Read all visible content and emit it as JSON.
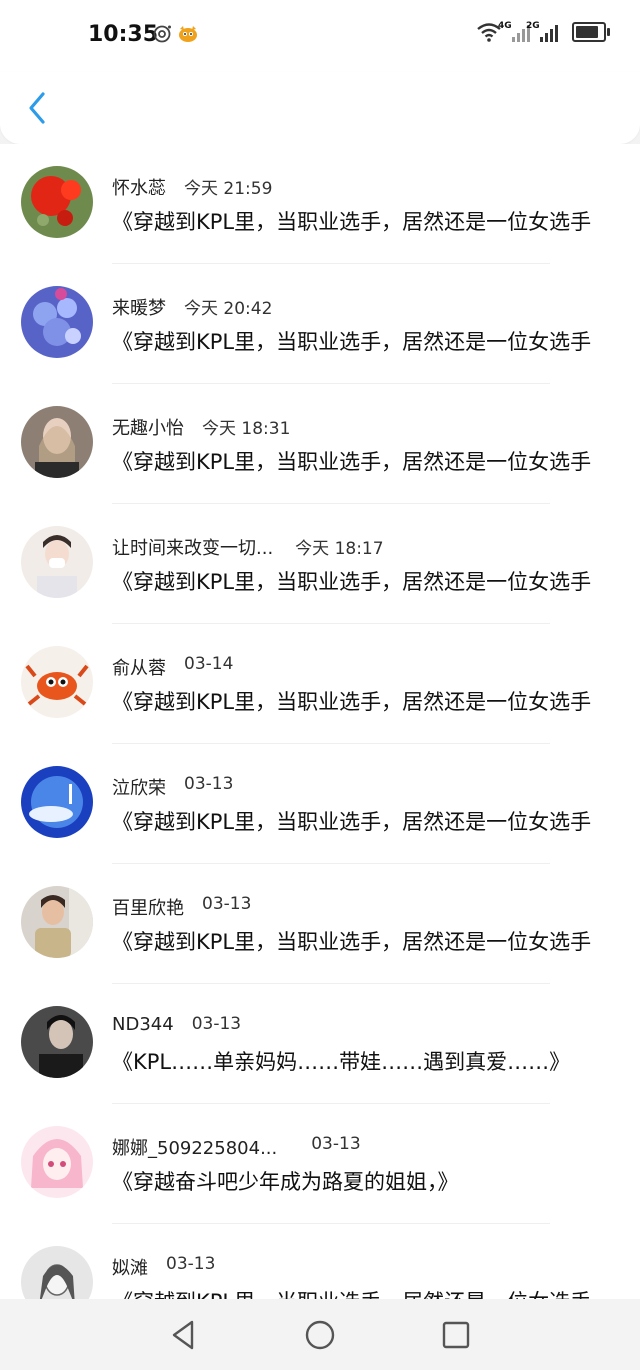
{
  "status_bar": {
    "time": "10:35",
    "network_1": "4G",
    "network_2": "2G",
    "icons": [
      "at-sign-icon",
      "cartoon-icon",
      "wifi-icon",
      "signal-icon",
      "signal-icon",
      "battery-icon"
    ]
  },
  "header": {
    "back_icon": "chevron-left-icon"
  },
  "items": [
    {
      "name": "怀水蕊",
      "time": "今天 21:59",
      "message": "《穿越到KPL里，当职业选手，居然还是一位女选手",
      "avatar": "red-cactus-flower"
    },
    {
      "name": "来暖梦",
      "time": "今天 20:42",
      "message": "《穿越到KPL里，当职业选手，居然还是一位女选手",
      "avatar": "blue-flowers"
    },
    {
      "name": "无趣小怡",
      "time": "今天 18:31",
      "message": "《穿越到KPL里，当职业选手，居然还是一位女选手",
      "avatar": "girl-portrait"
    },
    {
      "name": "让时间来改变一切...",
      "time": "今天 18:17",
      "message": "《穿越到KPL里，当职业选手，居然还是一位女选手",
      "avatar": "boy-portrait"
    },
    {
      "name": "俞从蓉",
      "time": "03-14",
      "message": "《穿越到KPL里，当职业选手，居然还是一位女选手",
      "avatar": "crab"
    },
    {
      "name": "泣欣荣",
      "time": "03-13",
      "message": "《穿越到KPL里，当职业选手，居然还是一位女选手",
      "avatar": "blue-mid-autumn"
    },
    {
      "name": "百里欣艳",
      "time": "03-13",
      "message": "《穿越到KPL里，当职业选手，居然还是一位女选手",
      "avatar": "woman-photo"
    },
    {
      "name": "ND344",
      "time": "03-13",
      "message": "《KPL……单亲妈妈……带娃……遇到真爱……》",
      "avatar": "dark-portrait"
    },
    {
      "name": "娜娜_509225804...",
      "time": "03-13",
      "message": "《穿越奋斗吧少年成为路夏的姐姐，》",
      "avatar": "anime-girl"
    },
    {
      "name": "姒滩",
      "time": "03-13",
      "message": "《穿越到KPL里，当职业选手，居然还是一位女选手",
      "avatar": "sketch-girl"
    }
  ],
  "nav_bar": {
    "icons": [
      "back-triangle-icon",
      "home-circle-icon",
      "recents-square-icon"
    ]
  }
}
